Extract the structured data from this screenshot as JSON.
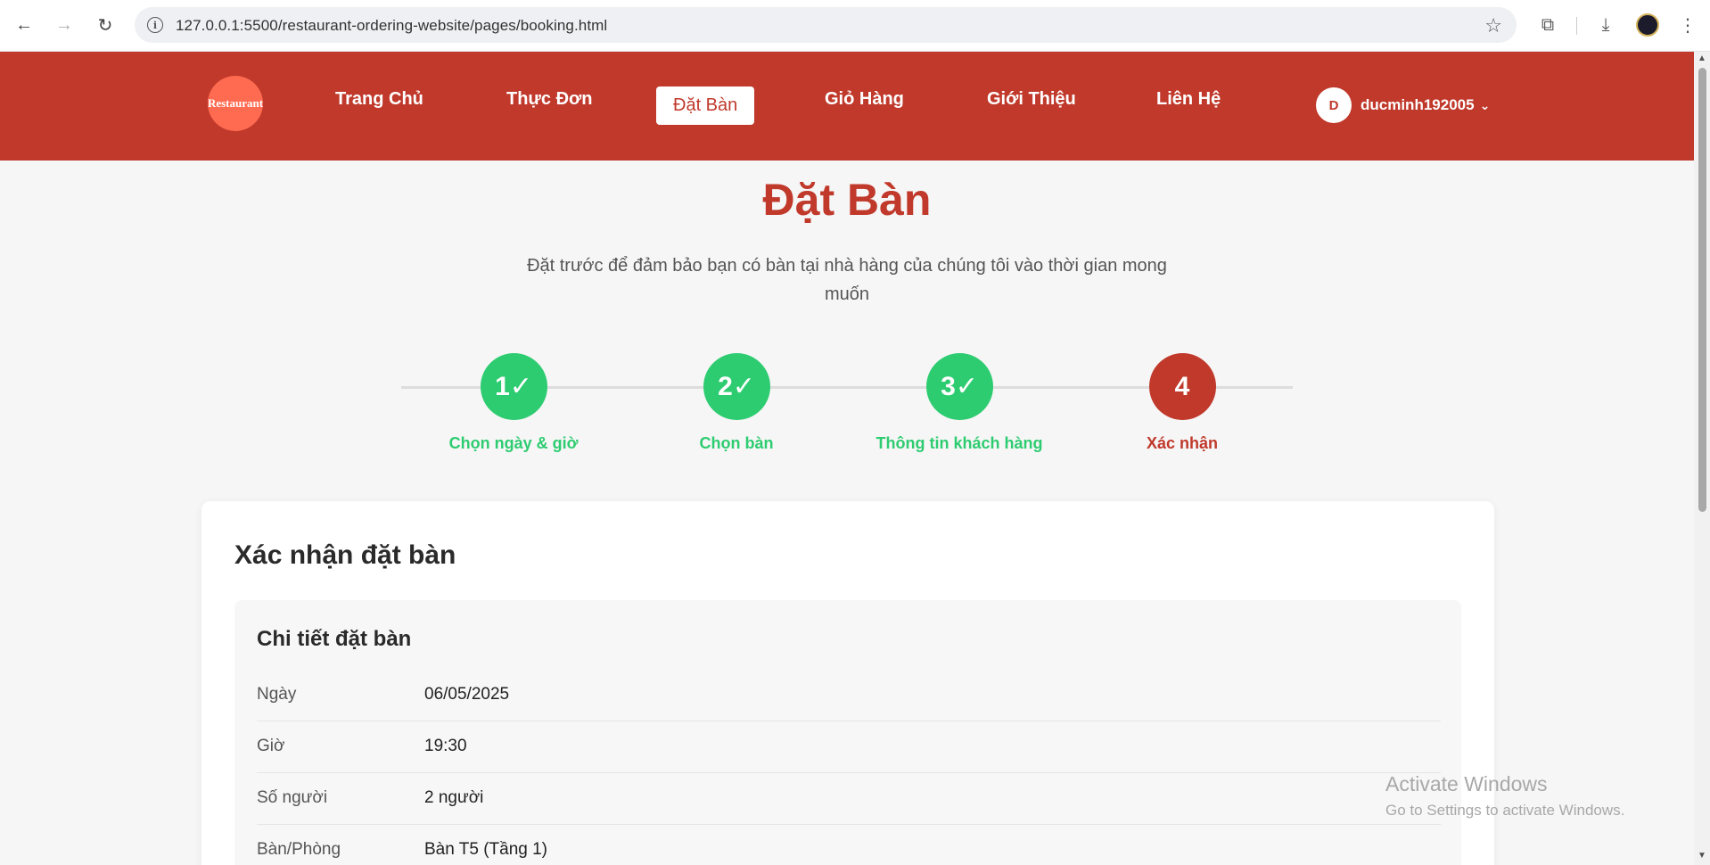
{
  "browser": {
    "url": "127.0.0.1:5500/restaurant-ordering-website/pages/booking.html",
    "back_icon": "←",
    "forward_icon": "→",
    "reload_icon": "↻",
    "star_icon": "☆",
    "info_icon": "i",
    "extensions_icon": "⧉",
    "download_icon": "⤓",
    "menu_icon": "⋮"
  },
  "header": {
    "logo_text": "Restaurant",
    "nav": [
      {
        "label": "Trang Chủ"
      },
      {
        "label": "Thực Đơn"
      },
      {
        "label": "Đặt Bàn"
      },
      {
        "label": "Giỏ Hàng"
      },
      {
        "label": "Giới Thiệu"
      },
      {
        "label": "Liên Hệ"
      }
    ],
    "user": {
      "initial": "D",
      "name": "ducminh192005",
      "chevron": "⌄"
    }
  },
  "page": {
    "title": "Đặt Bàn",
    "subtitle": "Đặt trước để đảm bảo bạn có bàn tại nhà hàng của chúng tôi vào thời gian mong muốn"
  },
  "steps": [
    {
      "badge": "1✓",
      "label": "Chọn ngày & giờ"
    },
    {
      "badge": "2✓",
      "label": "Chọn bàn"
    },
    {
      "badge": "3✓",
      "label": "Thông tin khách hàng"
    },
    {
      "badge": "4",
      "label": "Xác nhận"
    }
  ],
  "confirm": {
    "heading": "Xác nhận đặt bàn",
    "details_heading": "Chi tiết đặt bàn",
    "rows": [
      {
        "key": "Ngày",
        "value": "06/05/2025"
      },
      {
        "key": "Giờ",
        "value": "19:30"
      },
      {
        "key": "Số người",
        "value": "2 người"
      },
      {
        "key": "Bàn/Phòng",
        "value": "Bàn T5 (Tầng 1)"
      }
    ]
  },
  "watermark": {
    "line1": "Activate Windows",
    "line2": "Go to Settings to activate Windows."
  },
  "colors": {
    "brand": "#c0392b",
    "success": "#2ecc71"
  }
}
